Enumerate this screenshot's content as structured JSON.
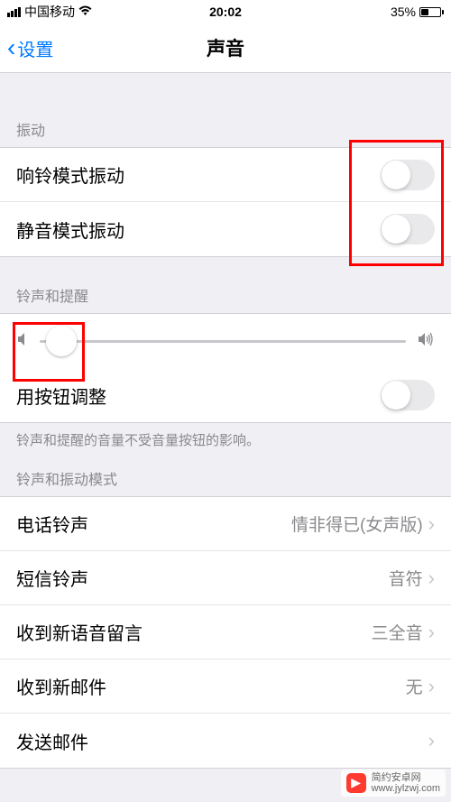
{
  "status": {
    "carrier": "中国移动",
    "time": "20:02",
    "battery_pct": "35%"
  },
  "nav": {
    "back_label": "设置",
    "title": "声音"
  },
  "sections": {
    "vibrate_header": "振动",
    "ring_vibrate_label": "响铃模式振动",
    "silent_vibrate_label": "静音模式振动",
    "ringtone_header": "铃声和提醒",
    "button_adjust_label": "用按钮调整",
    "footer_note": "铃声和提醒的音量不受音量按钮的影响。",
    "pattern_header": "铃声和振动模式"
  },
  "rows": {
    "call_ringtone_label": "电话铃声",
    "call_ringtone_value": "情非得已(女声版)",
    "sms_ringtone_label": "短信铃声",
    "sms_ringtone_value": "音符",
    "voicemail_label": "收到新语音留言",
    "voicemail_value": "三全音",
    "mail_label": "收到新邮件",
    "mail_value": "无",
    "send_mail_label": "发送邮件",
    "send_mail_value": ""
  },
  "watermark": {
    "line1": "简约安卓网",
    "line2": "www.jylzwj.com"
  }
}
